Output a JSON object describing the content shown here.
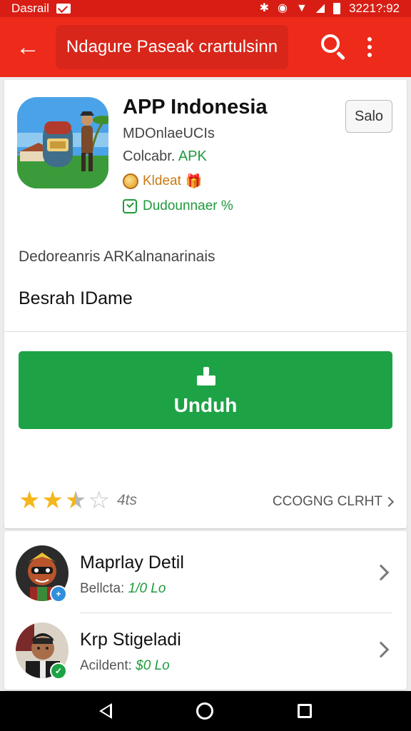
{
  "status_bar": {
    "left_text": "Dasrail",
    "time": "3221?:92"
  },
  "app_bar": {
    "title": "Ndagure Paseak crartulsinn"
  },
  "app": {
    "name": "APP Indonesia",
    "developer": "MDOnlaeUCIs",
    "category_prefix": "Colcabr.",
    "category_tag": "APK",
    "badge_text": "Kldeat",
    "verified_text": "Dudounnaer %",
    "sale_label": "Salo",
    "description": "Dedoreanris ARKalnanarinais",
    "subtitle": "Besrah IDame"
  },
  "download": {
    "label": "Unduh"
  },
  "rating": {
    "stars": 2.5,
    "max_stars": 5,
    "count_text": "4ts",
    "checking_text": "CCOGNG CLRHT"
  },
  "list": {
    "items": [
      {
        "title": "Maprlay Detil",
        "sub_prefix": "Bellcta:",
        "sub_value": "1/0 Lo"
      },
      {
        "title": "Krp Stigeladi",
        "sub_prefix": "Acildent:",
        "sub_value": "$0 Lo"
      }
    ]
  },
  "colors": {
    "status_bar": "#d81e14",
    "app_bar": "#ee2a1b",
    "primary_green": "#1da345",
    "star": "#f4b71b"
  }
}
